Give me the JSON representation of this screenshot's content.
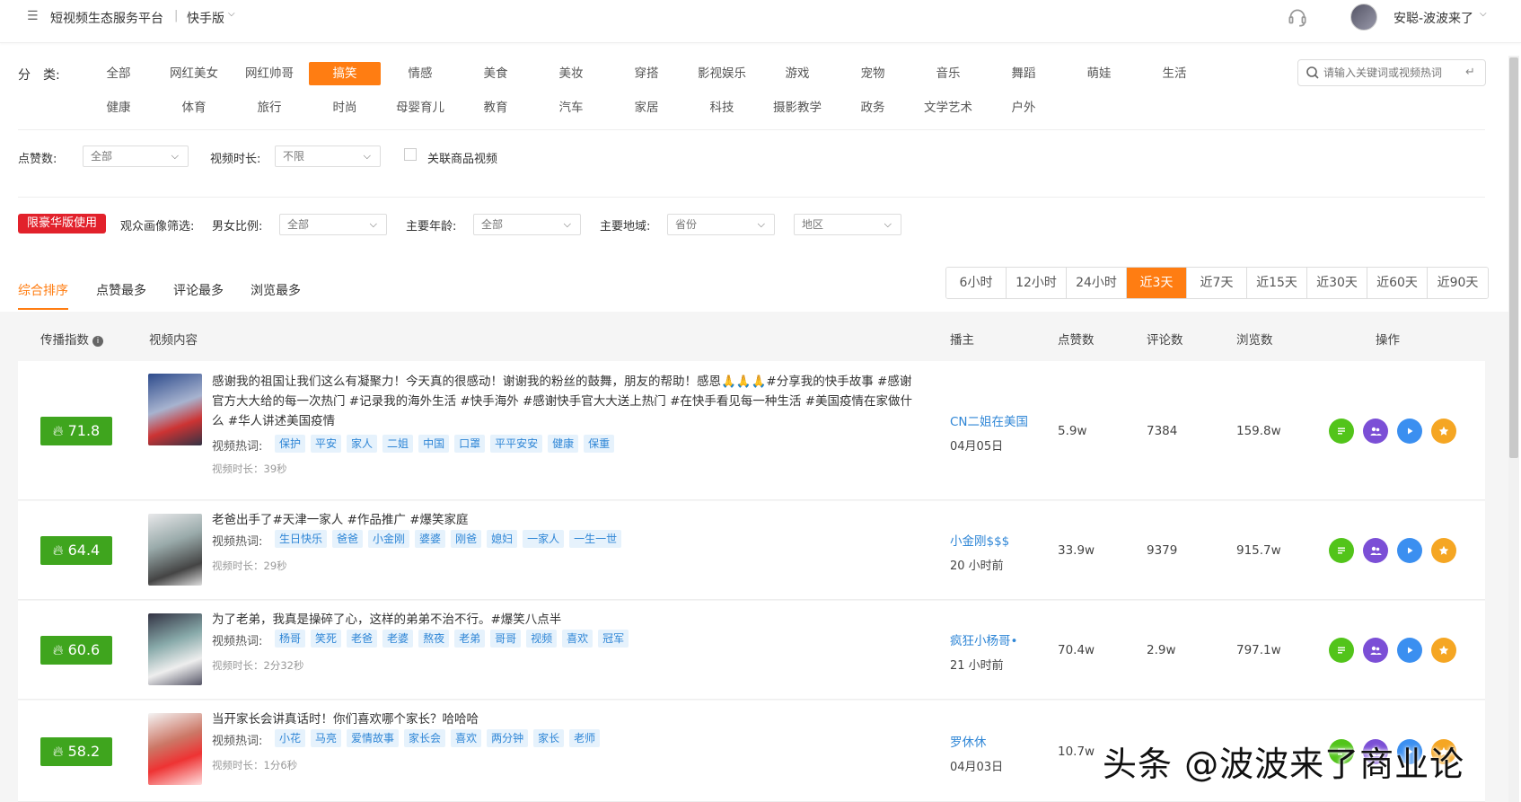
{
  "header": {
    "platform": "短视频生态服务平台",
    "separator": "|",
    "edition": "快手版",
    "username": "安聪-波波来了"
  },
  "filters": {
    "category_label": "分　类:",
    "categories_row1": [
      "全部",
      "网红美女",
      "网红帅哥",
      "搞笑",
      "情感",
      "美食",
      "美妆",
      "穿搭",
      "影视娱乐",
      "游戏",
      "宠物",
      "音乐",
      "舞蹈",
      "萌娃",
      "生活"
    ],
    "categories_row2": [
      "健康",
      "体育",
      "旅行",
      "时尚",
      "母婴育儿",
      "教育",
      "汽车",
      "家居",
      "科技",
      "摄影教学",
      "政务",
      "文学艺术",
      "户外"
    ],
    "active_category": "搞笑",
    "search_placeholder": "请输入关键词或视频热词",
    "likes_label": "点赞数:",
    "likes_value": "全部",
    "duration_label": "视频时长:",
    "duration_value": "不限",
    "related_goods_label": "关联商品视频",
    "premium_badge": "限豪华版使用",
    "audience_label": "观众画像筛选:",
    "gender_label": "男女比例:",
    "gender_value": "全部",
    "age_label": "主要年龄:",
    "age_value": "全部",
    "region_label": "主要地域:",
    "province_value": "省份",
    "area_value": "地区"
  },
  "sort_tabs": [
    "综合排序",
    "点赞最多",
    "评论最多",
    "浏览最多"
  ],
  "time_ranges": [
    "6小时",
    "12小时",
    "24小时",
    "近3天",
    "近7天",
    "近15天",
    "近30天",
    "近60天",
    "近90天"
  ],
  "active_time_range": "近3天",
  "table": {
    "headers": {
      "index": "传播指数",
      "content": "视频内容",
      "anchor": "播主",
      "likes": "点赞数",
      "comments": "评论数",
      "views": "浏览数",
      "actions": "操作"
    },
    "tags_label": "视频热词:",
    "rows": [
      {
        "score": "71.8",
        "title": "感谢我的祖国让我们这么有凝聚力！今天真的很感动！谢谢我的粉丝的鼓舞，朋友的帮助！感恩🙏🙏🙏#分享我的快手故事 #感谢官方大大给的每一次热门 #记录我的海外生活 #快手海外 #感谢快手官大大送上热门 #在快手看见每一种生活 #美国疫情在家做什么 #华人讲述美国疫情",
        "tags": [
          "保护",
          "平安",
          "家人",
          "二姐",
          "中国",
          "口罩",
          "平平安安",
          "健康",
          "保重"
        ],
        "duration": "视频时长：39秒",
        "anchor": "CN二姐在美国",
        "time": "04月05日",
        "likes": "5.9w",
        "comments": "7384",
        "views": "159.8w"
      },
      {
        "score": "64.4",
        "title": "老爸出手了#天津一家人 #作品推广 #爆笑家庭",
        "tags": [
          "生日快乐",
          "爸爸",
          "小金刚",
          "婆婆",
          "刚爸",
          "媳妇",
          "一家人",
          "一生一世"
        ],
        "duration": "视频时长：29秒",
        "anchor": "小金刚$$$",
        "time": "20 小时前",
        "likes": "33.9w",
        "comments": "9379",
        "views": "915.7w"
      },
      {
        "score": "60.6",
        "title": "为了老弟，我真是操碎了心，这样的弟弟不治不行。#爆笑八点半",
        "tags": [
          "杨哥",
          "笑死",
          "老爸",
          "老婆",
          "熬夜",
          "老弟",
          "哥哥",
          "视频",
          "喜欢",
          "冠军"
        ],
        "duration": "视频时长：2分32秒",
        "anchor": "疯狂小杨哥•",
        "time": "21 小时前",
        "likes": "70.4w",
        "comments": "2.9w",
        "views": "797.1w"
      },
      {
        "score": "58.2",
        "title": "当开家长会讲真话时！你们喜欢哪个家长？哈哈哈",
        "tags": [
          "小花",
          "马亮",
          "爱情故事",
          "家长会",
          "喜欢",
          "两分钟",
          "家长",
          "老师"
        ],
        "duration": "视频时长：1分6秒",
        "anchor": "罗休休",
        "time": "04月03日",
        "likes": "10.7w",
        "comments": "",
        "views": ""
      }
    ]
  },
  "watermark": "头条 @波波来了商业论",
  "colors": {
    "accent": "#ff7d12",
    "score_green": "#3fa51e",
    "link_blue": "#2f86d6",
    "premium_red": "#e2212b",
    "op_green": "#52c41a",
    "op_purple": "#7b4fd6",
    "op_blue": "#3b8ff0",
    "op_orange": "#f5a623"
  }
}
